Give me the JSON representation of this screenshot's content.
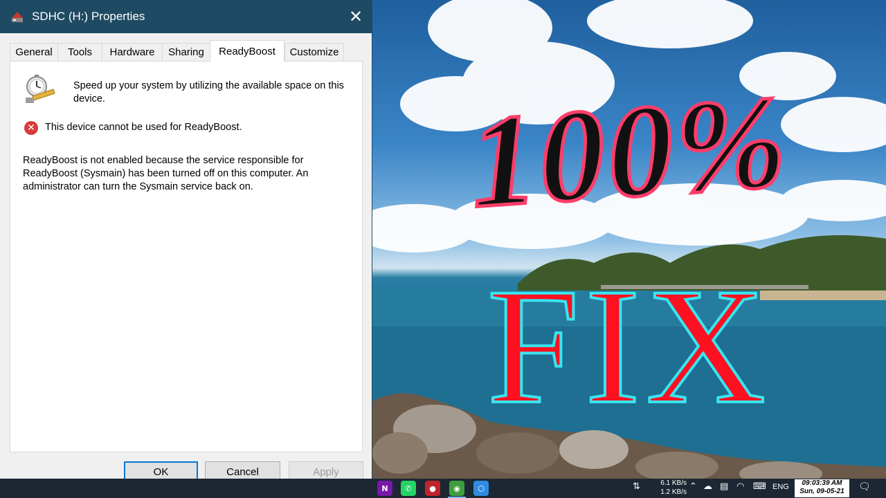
{
  "window": {
    "title": "SDHC (H:) Properties",
    "close_glyph": "✕"
  },
  "tabs": [
    {
      "label": "General"
    },
    {
      "label": "Tools"
    },
    {
      "label": "Hardware"
    },
    {
      "label": "Sharing"
    },
    {
      "label": "ReadyBoost",
      "active": true
    },
    {
      "label": "Customize"
    }
  ],
  "readyboost": {
    "intro": "Speed up your system by utilizing the available space on this device.",
    "error_glyph": "✕",
    "error": "This device cannot be used for ReadyBoost.",
    "detail": "ReadyBoost is not enabled because the service responsible for ReadyBoost (Sysmain) has been turned off on this computer. An administrator can turn the Sysmain service back on."
  },
  "buttons": {
    "ok": "OK",
    "cancel": "Cancel",
    "apply": "Apply"
  },
  "overlay": {
    "top": "100%",
    "bottom": "FIX"
  },
  "taskbar": {
    "apps": [
      {
        "icon": "onenote-icon",
        "glyph": "N",
        "color": "#7719aa"
      },
      {
        "icon": "whatsapp-icon",
        "glyph": "✆",
        "color": "#25d366"
      },
      {
        "icon": "recorder-icon",
        "glyph": "●",
        "color": "#c0232b"
      },
      {
        "icon": "browser-icon",
        "glyph": "◉",
        "color": "#3f9e3f"
      },
      {
        "icon": "package-icon",
        "glyph": "⬡",
        "color": "#2f8be0"
      }
    ],
    "net_up": "6.1 KB/s",
    "net_down": "1.2 KB/s",
    "language": "ENG",
    "time": "09:03:39 AM",
    "date": "Sun, 09-05-21"
  }
}
